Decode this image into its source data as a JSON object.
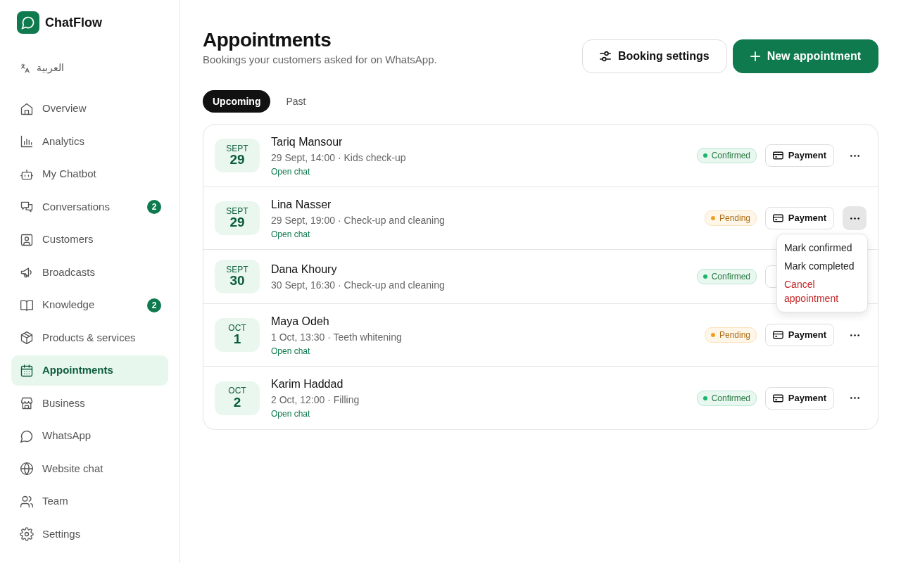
{
  "brand": {
    "name": "ChatFlow"
  },
  "language": {
    "label": "العربية"
  },
  "sidebar": {
    "items": [
      {
        "label": "Overview",
        "selected": false
      },
      {
        "label": "Analytics",
        "selected": false
      },
      {
        "label": "My Chatbot",
        "selected": false
      },
      {
        "label": "Conversations",
        "selected": false,
        "badge": "2"
      },
      {
        "label": "Customers",
        "selected": false
      },
      {
        "label": "Broadcasts",
        "selected": false
      },
      {
        "label": "Knowledge",
        "selected": false,
        "badge": "2"
      },
      {
        "label": "Products & services",
        "selected": false
      },
      {
        "label": "Appointments",
        "selected": true
      },
      {
        "label": "Business",
        "selected": false
      },
      {
        "label": "WhatsApp",
        "selected": false
      },
      {
        "label": "Website chat",
        "selected": false
      },
      {
        "label": "Team",
        "selected": false
      },
      {
        "label": "Settings",
        "selected": false
      }
    ]
  },
  "header": {
    "title": "Appointments",
    "subtitle": "Bookings your customers asked for on WhatsApp.",
    "buttons": [
      {
        "label": "Booking settings",
        "kind": "secondary"
      },
      {
        "label": "New appointment",
        "kind": "primary"
      }
    ]
  },
  "tabs": [
    {
      "label": "Upcoming",
      "selected": true
    },
    {
      "label": "Past",
      "selected": false
    }
  ],
  "appointments": [
    {
      "month": "SEPT",
      "day": "29",
      "name": "Tariq Mansour",
      "details": "29 Sept, 14:00 · Kids check-up",
      "link": "Open chat",
      "status": "Confirmed",
      "color": "#1cb36b",
      "payment": "Payment",
      "menu_open": false
    },
    {
      "month": "SEPT",
      "day": "29",
      "name": "Lina Nasser",
      "details": "29 Sept, 19:00 · Check-up and cleaning",
      "link": "Open chat",
      "status": "Pending",
      "color": "#f0a020",
      "payment": "Payment",
      "menu_open": true,
      "menu": [
        {
          "label": "Mark confirmed",
          "kind": "normal"
        },
        {
          "label": "Mark completed",
          "kind": "normal"
        },
        {
          "label": "Cancel appointment",
          "kind": "danger"
        }
      ]
    },
    {
      "month": "SEPT",
      "day": "30",
      "name": "Dana Khoury",
      "details": "30 Sept, 16:30 · Check-up and cleaning",
      "status": "Confirmed",
      "color": "#1cb36b"
    },
    {
      "month": "OCT",
      "day": "1",
      "name": "Maya Odeh",
      "details": "1 Oct, 13:30 · Teeth whitening",
      "link": "Open chat",
      "status": "Pending",
      "color": "#f0a020",
      "payment": "Payment",
      "menu_open": false
    },
    {
      "month": "OCT",
      "day": "2",
      "name": "Karim Haddad",
      "details": "2 Oct, 12:00 · Filling",
      "link": "Open chat",
      "status": "Confirmed",
      "color": "#1cb36b",
      "payment": "Payment",
      "menu_open": false
    }
  ]
}
